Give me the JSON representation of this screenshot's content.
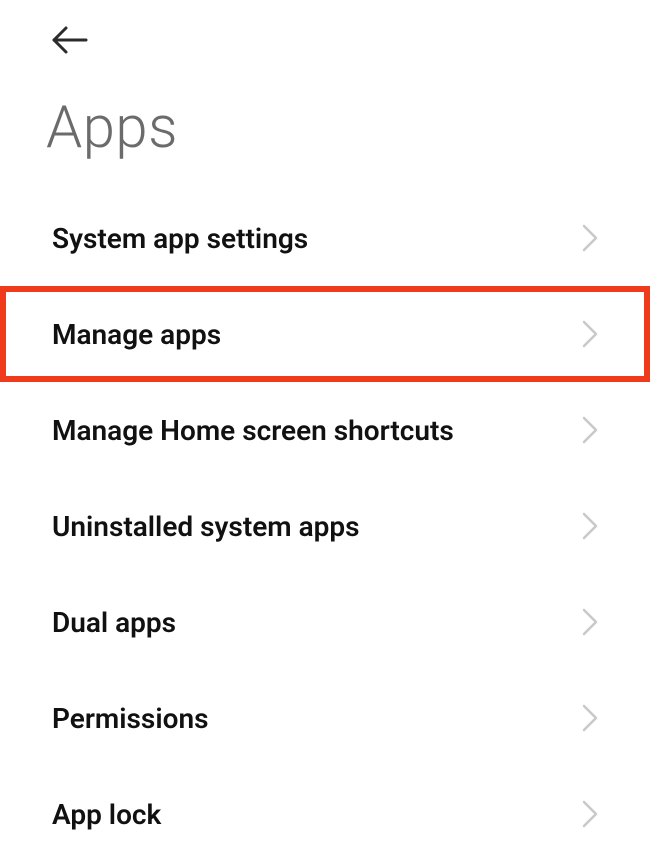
{
  "header": {
    "title": "Apps"
  },
  "menu": {
    "items": [
      {
        "label": "System app settings"
      },
      {
        "label": "Manage apps"
      },
      {
        "label": "Manage Home screen shortcuts"
      },
      {
        "label": "Uninstalled system apps"
      },
      {
        "label": "Dual apps"
      },
      {
        "label": "Permissions"
      },
      {
        "label": "App lock"
      }
    ]
  },
  "highlight_index": 1,
  "colors": {
    "highlight": "#ef3b1c",
    "title": "#6b6b6b",
    "text": "#111111",
    "chevron": "#c9c9c9",
    "back_arrow": "#2b2b2b"
  }
}
